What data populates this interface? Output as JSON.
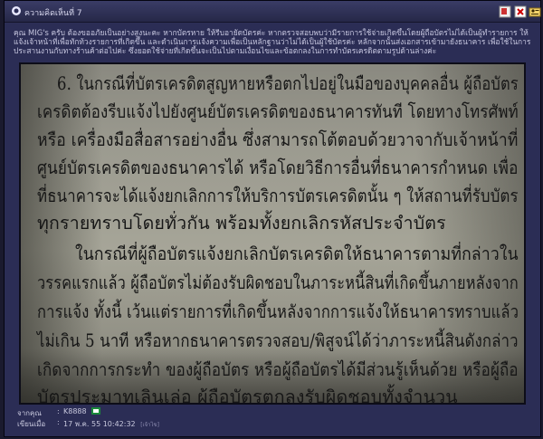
{
  "header": {
    "title": "ความคิดเห็นที่ 7"
  },
  "post": {
    "text": "คุณ MIG's ครับ ต้องขออภัยเป็นอย่างสูงนะคะ หากบัตรหาย ให้รีบอายัดบัตรค่ะ หากตรวจสอบพบว่ามีรายการใช้จ่ายเกิดขึ้นโดยผู้ถือบัตรไม่ได้เป็นผู้ทำรายการ ให้แจ้งเจ้าหน้าที่เพื่อทักท้วงรายการที่เกิดขึ้น และดำเนินการแจ้งความเพื่อเป็นหลักฐานว่าไม่ได้เป็นผู้ใช้บัตรค่ะ หลักจากนั้นส่งเอกสารเข้ามายังธนาคาร เพื่อใช้ในการประสานงานกับทางร้านค้าต่อไปค่ะ ซึ่งยอดใช้จ่ายที่เกิดขึ้นจะเป็นไปตามเงื่อนไขและข้อตกลงในการทำบัตรเครดิตตามรูปด้านล่างค่ะ",
    "image_lines": [
      "6. ในกรณีที่บัตรเครดิตสูญหายหรือตกไปอยู่ในมือของบุคคลอื่น ผู้ถือบัตร",
      "เครดิตต้องรีบแจ้งไปยังศูนย์บัตรเครดิตของธนาคารทันที โดยทางโทรศัพท์",
      "หรือ เครื่องมือสื่อสารอย่างอื่น ซึ่งสามารถโต้ตอบด้วยวาจากับเจ้าหน้าที่",
      "ศูนย์บัตรเครดิตของธนาคารได้ หรือโดยวิธีการอื่นที่ธนาคารกำหนด เพื่อ",
      "ที่ธนาคารจะได้แจ้งยกเลิกการให้บริการบัตรเครดิตนั้น ๆ ให้สถานที่รับบัตร",
      "ทุกรายทราบโดยทั่วกัน พร้อมทั้งยกเลิกรหัสประจำบัตร",
      "ในกรณีที่ผู้ถือบัตรแจ้งยกเลิกบัตรเครดิตให้ธนาคารตามที่กล่าวใน",
      "วรรคแรกแล้ว ผู้ถือบัตรไม่ต้องรับผิดชอบในภาระหนี้สินที่เกิดขึ้นภายหลังจาก",
      "การแจ้ง ทั้งนี้ เว้นแต่รายการที่เกิดขึ้นหลังจากการแจ้งให้ธนาคารทราบแล้ว",
      "ไม่เกิน 5 นาที หรือหากธนาคารตรวจสอบ/พิสูจน์ได้ว่าภาระหนี้สินดังกล่าว",
      "เกิดจากการกระทำ ของผู้ถือบัตร หรือผู้ถือบัตรได้มีส่วนรู้เห็นด้วย หรือผู้ถือ",
      "บัตรประมาทเลินเล่อ ผู้ถือบัตรตกลงรับผิดชอบทั้งจำนวน"
    ]
  },
  "footer": {
    "from_label": "จากคุณ",
    "from_value": "K8888",
    "date_label": "เขียนเมื่อ",
    "date_value": "17 พ.ค. 55 10:42:32",
    "date_extra": "[เจ้าไข]"
  },
  "icons": {
    "header_icon": "chat-bubble-icon",
    "report": "report-icon",
    "delete": "delete-x-icon",
    "quote": "quote-icon",
    "flag": "bank-logo-icon"
  }
}
